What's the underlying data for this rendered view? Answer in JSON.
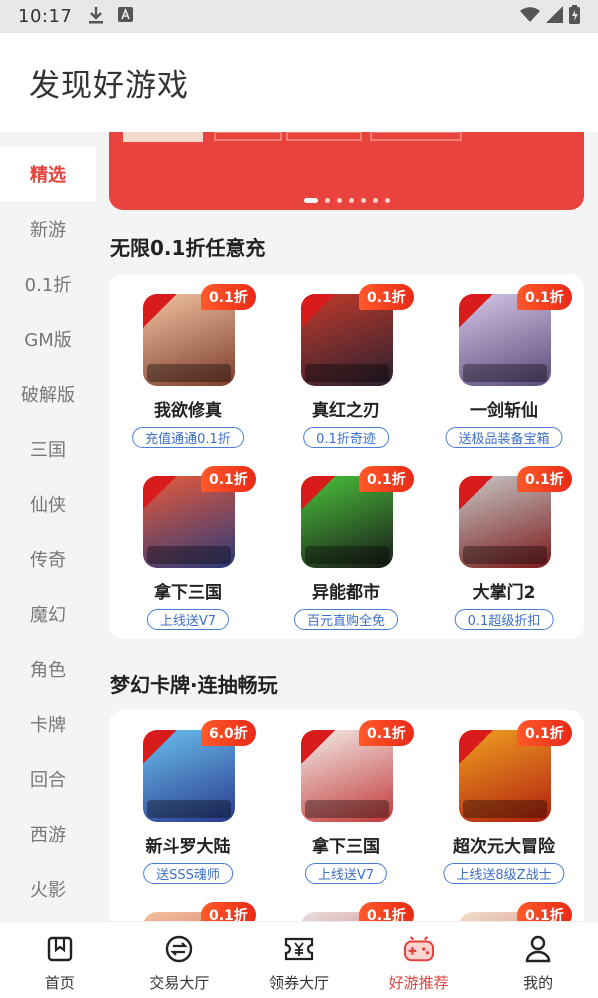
{
  "status_bar": {
    "time": "10:17",
    "icons_left": [
      "download-icon",
      "font-a-icon"
    ],
    "icons_right": [
      "wifi-icon",
      "signal-icon",
      "battery-icon"
    ]
  },
  "header": {
    "title": "发现好游戏"
  },
  "sidebar": {
    "items": [
      {
        "label": "精选",
        "active": true
      },
      {
        "label": "新游"
      },
      {
        "label": "0.1折"
      },
      {
        "label": "GM版"
      },
      {
        "label": "破解版"
      },
      {
        "label": "三国"
      },
      {
        "label": "仙侠"
      },
      {
        "label": "传奇"
      },
      {
        "label": "魔幻"
      },
      {
        "label": "角色"
      },
      {
        "label": "卡牌"
      },
      {
        "label": "回合"
      },
      {
        "label": "西游"
      },
      {
        "label": "火影"
      }
    ]
  },
  "banner": {
    "dot_count": 7,
    "active_dot": 0,
    "color": "#e8443d"
  },
  "sections": [
    {
      "title": "无限0.1折任意充",
      "games": [
        {
          "name": "我欲修真",
          "discount": "0.1折",
          "tag": "充值通通0.1折",
          "colors": [
            "#f3c3a4",
            "#7b3d2a"
          ]
        },
        {
          "name": "真红之刃",
          "discount": "0.1折",
          "tag": "0.1折奇迹",
          "colors": [
            "#c23a2a",
            "#2a2030"
          ]
        },
        {
          "name": "一剑斩仙",
          "discount": "0.1折",
          "tag": "送极品装备宝箱",
          "colors": [
            "#d7c7e8",
            "#5a4a7a"
          ]
        },
        {
          "name": "拿下三国",
          "discount": "0.1折",
          "tag": "上线送V7",
          "colors": [
            "#e85a3a",
            "#2a3a7a"
          ]
        },
        {
          "name": "异能都市",
          "discount": "0.1折",
          "tag": "百元直购全免",
          "colors": [
            "#4ac23a",
            "#1a1a1a"
          ]
        },
        {
          "name": "大掌门2",
          "discount": "0.1折",
          "tag": "0.1超级折扣",
          "colors": [
            "#c8c8c8",
            "#7a1a1a"
          ]
        }
      ]
    },
    {
      "title": "梦幻卡牌·连抽畅玩",
      "games": [
        {
          "name": "新斗罗大陆",
          "discount": "6.0折",
          "tag": "送SSS魂师",
          "colors": [
            "#6ac0f0",
            "#2a3a8a"
          ]
        },
        {
          "name": "拿下三国",
          "discount": "0.1折",
          "tag": "上线送V7",
          "colors": [
            "#f2ece8",
            "#c23a3a"
          ]
        },
        {
          "name": "超次元大冒险",
          "discount": "0.1折",
          "tag": "上线送8级Z战士",
          "colors": [
            "#f0a020",
            "#b02010"
          ]
        }
      ],
      "more_discounts": [
        "0.1折",
        "0.1折",
        "0.1折"
      ]
    }
  ],
  "tabbar": {
    "items": [
      {
        "label": "首页",
        "icon": "home-icon"
      },
      {
        "label": "交易大厅",
        "icon": "trade-icon"
      },
      {
        "label": "领券大厅",
        "icon": "coupon-icon"
      },
      {
        "label": "好游推荐",
        "icon": "gamepad-icon",
        "active": true
      },
      {
        "label": "我的",
        "icon": "user-icon"
      }
    ]
  },
  "colors": {
    "accent": "#e5413a",
    "tag_blue": "#3c6ec8"
  }
}
